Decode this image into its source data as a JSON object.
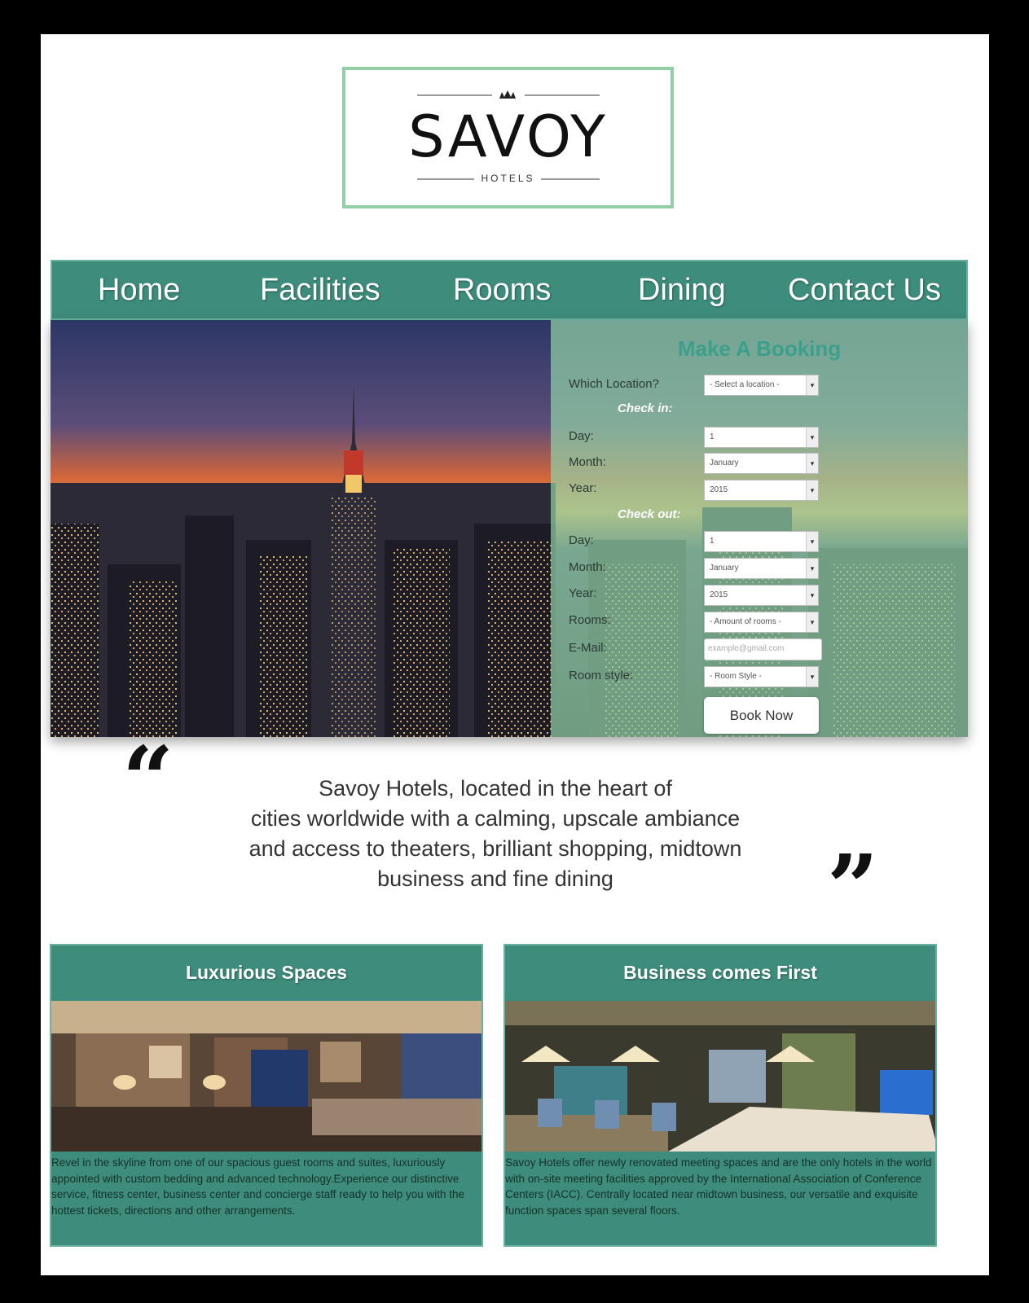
{
  "logo": {
    "word": "SAVOY",
    "sub": "HOTELS"
  },
  "nav": [
    {
      "label": "Home"
    },
    {
      "label": "Facilities"
    },
    {
      "label": "Rooms"
    },
    {
      "label": "Dining"
    },
    {
      "label": "Contact Us"
    }
  ],
  "booking": {
    "title": "Make A Booking",
    "location_label": "Which Location?",
    "location_value": "- Select a location -",
    "checkin_heading": "Check in:",
    "checkout_heading": "Check out:",
    "day_label": "Day:",
    "month_label": "Month:",
    "year_label": "Year:",
    "checkin_day": "1",
    "checkin_month": "January",
    "checkin_year": "2015",
    "checkout_day": "1",
    "checkout_month": "January",
    "checkout_year": "2015",
    "rooms_label": "Rooms:",
    "rooms_value": "- Amount of rooms -",
    "email_label": "E-Mail:",
    "email_placeholder": "example@gmail.com",
    "style_label": "Room style:",
    "style_value": "- Room Style -",
    "book_button": "Book Now"
  },
  "quote": {
    "open_mark": "“",
    "close_mark": "”",
    "line1": "Savoy Hotels, located in the heart of",
    "line2": "cities worldwide with a calming, upscale ambiance",
    "line3": "and access to theaters, brilliant shopping, midtown",
    "line4": "business and fine dining"
  },
  "cards": [
    {
      "title": "Luxurious Spaces",
      "text": "Revel in the skyline from one of our spacious guest rooms and suites, luxuriously appointed with custom bedding and advanced technology.Experience our distinctive service, fitness center, business center and concierge staff ready to help you with the hottest tickets, directions and other arrangements."
    },
    {
      "title": "Business comes First",
      "text": "Savoy Hotels offer newly renovated meeting spaces and are the only hotels in the world with on-site meeting facilities approved by the International Association of Conference Centers (IACC). Centrally located near midtown business, our versatile and exquisite function spaces span several floors."
    }
  ],
  "colors": {
    "teal": "#3d8c7c",
    "mint": "#93cfa6",
    "accent": "#3aa08c"
  }
}
